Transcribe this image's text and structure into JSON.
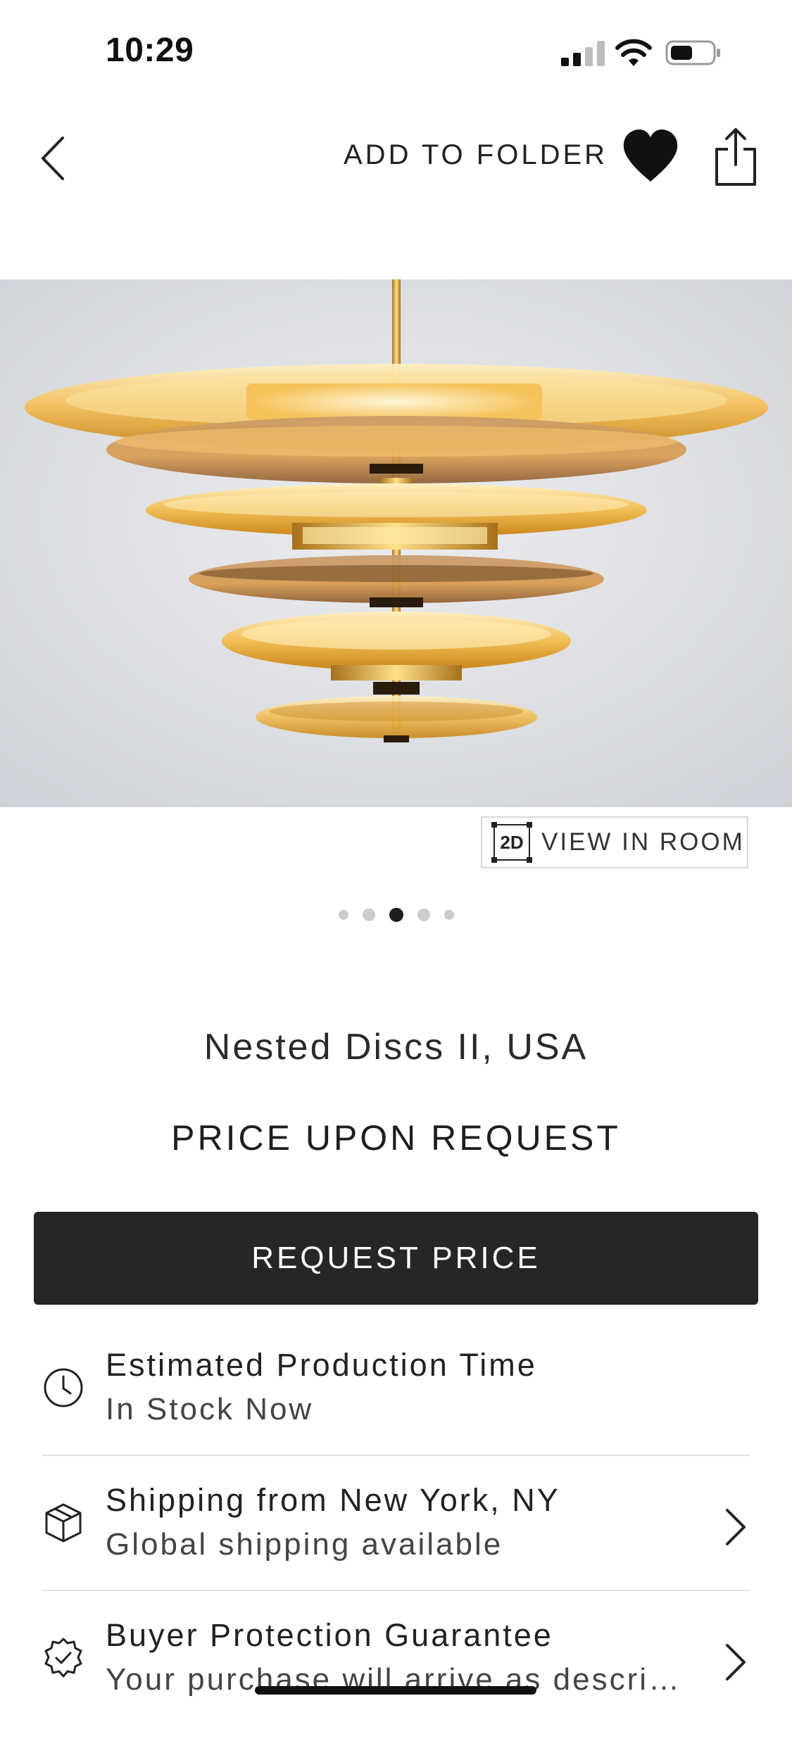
{
  "status_bar": {
    "time": "10:29"
  },
  "nav": {
    "add_to_folder_label": "ADD TO FOLDER"
  },
  "gallery": {
    "view_in_room_label": "VIEW IN ROOM",
    "badge_label": "2D",
    "dot_count": 5,
    "active_dot": 3
  },
  "product": {
    "title": "Nested Discs II, USA",
    "price": "PRICE UPON REQUEST",
    "request_button_label": "REQUEST PRICE"
  },
  "info": [
    {
      "title": "Estimated Production Time",
      "subtitle": "In Stock Now",
      "icon": "clock-icon"
    },
    {
      "title": "Shipping from New York, NY",
      "subtitle": "Global shipping available",
      "icon": "box-icon"
    },
    {
      "title": "Buyer Protection Guarantee",
      "subtitle": "Your purchase will arrive as descri…",
      "icon": "badge-check-icon"
    }
  ],
  "colors": {
    "button_bg": "#262626",
    "text": "#222222",
    "divider": "#e2e2e2",
    "accent_amber": "#e9a93a"
  }
}
